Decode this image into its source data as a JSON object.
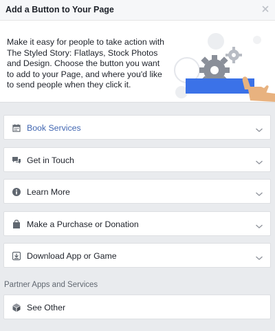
{
  "dialog": {
    "title": "Add a Button to Your Page",
    "close_icon": "close-icon"
  },
  "intro": {
    "description": "Make it easy for people to take action with The Styled Story: Flatlays, Stock Photos and Design. Choose the button you want to add to your Page, and where you'd like to send people when they click it."
  },
  "options": [
    {
      "label": "Book Services",
      "icon": "calendar-icon",
      "active": true
    },
    {
      "label": "Get in Touch",
      "icon": "chat-icon",
      "active": false
    },
    {
      "label": "Learn More",
      "icon": "info-icon",
      "active": false
    },
    {
      "label": "Make a Purchase or Donation",
      "icon": "shopping-bag-icon",
      "active": false
    },
    {
      "label": "Download App or Game",
      "icon": "download-icon",
      "active": false
    }
  ],
  "partner": {
    "section_label": "Partner Apps and Services",
    "see_other_label": "See Other",
    "see_other_icon": "cube-icon"
  },
  "colors": {
    "accent": "#4267b2",
    "illustration_button": "#3b72e8",
    "hand": "#e8b27f"
  }
}
